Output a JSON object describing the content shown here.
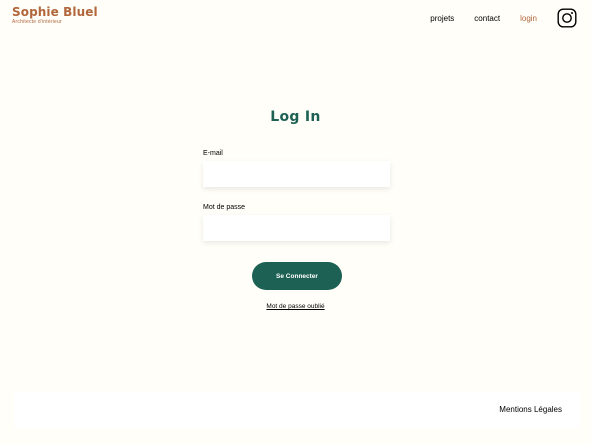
{
  "header": {
    "brand_name": "Sophie Bluel",
    "brand_subtitle": "Architecte d'intérieur",
    "nav": {
      "projets": "projets",
      "contact": "contact",
      "login": "login"
    },
    "social_icon": "instagram-icon",
    "accent_color": "#B1663C"
  },
  "login": {
    "title": "Log In",
    "email_label": "E-mail",
    "email_value": "",
    "password_label": "Mot de passe",
    "password_value": "",
    "submit_label": "Se Connecter",
    "forgot_label": "Mot de passe oublié",
    "primary_color": "#1D6154"
  },
  "footer": {
    "legal_label": "Mentions Légales"
  }
}
